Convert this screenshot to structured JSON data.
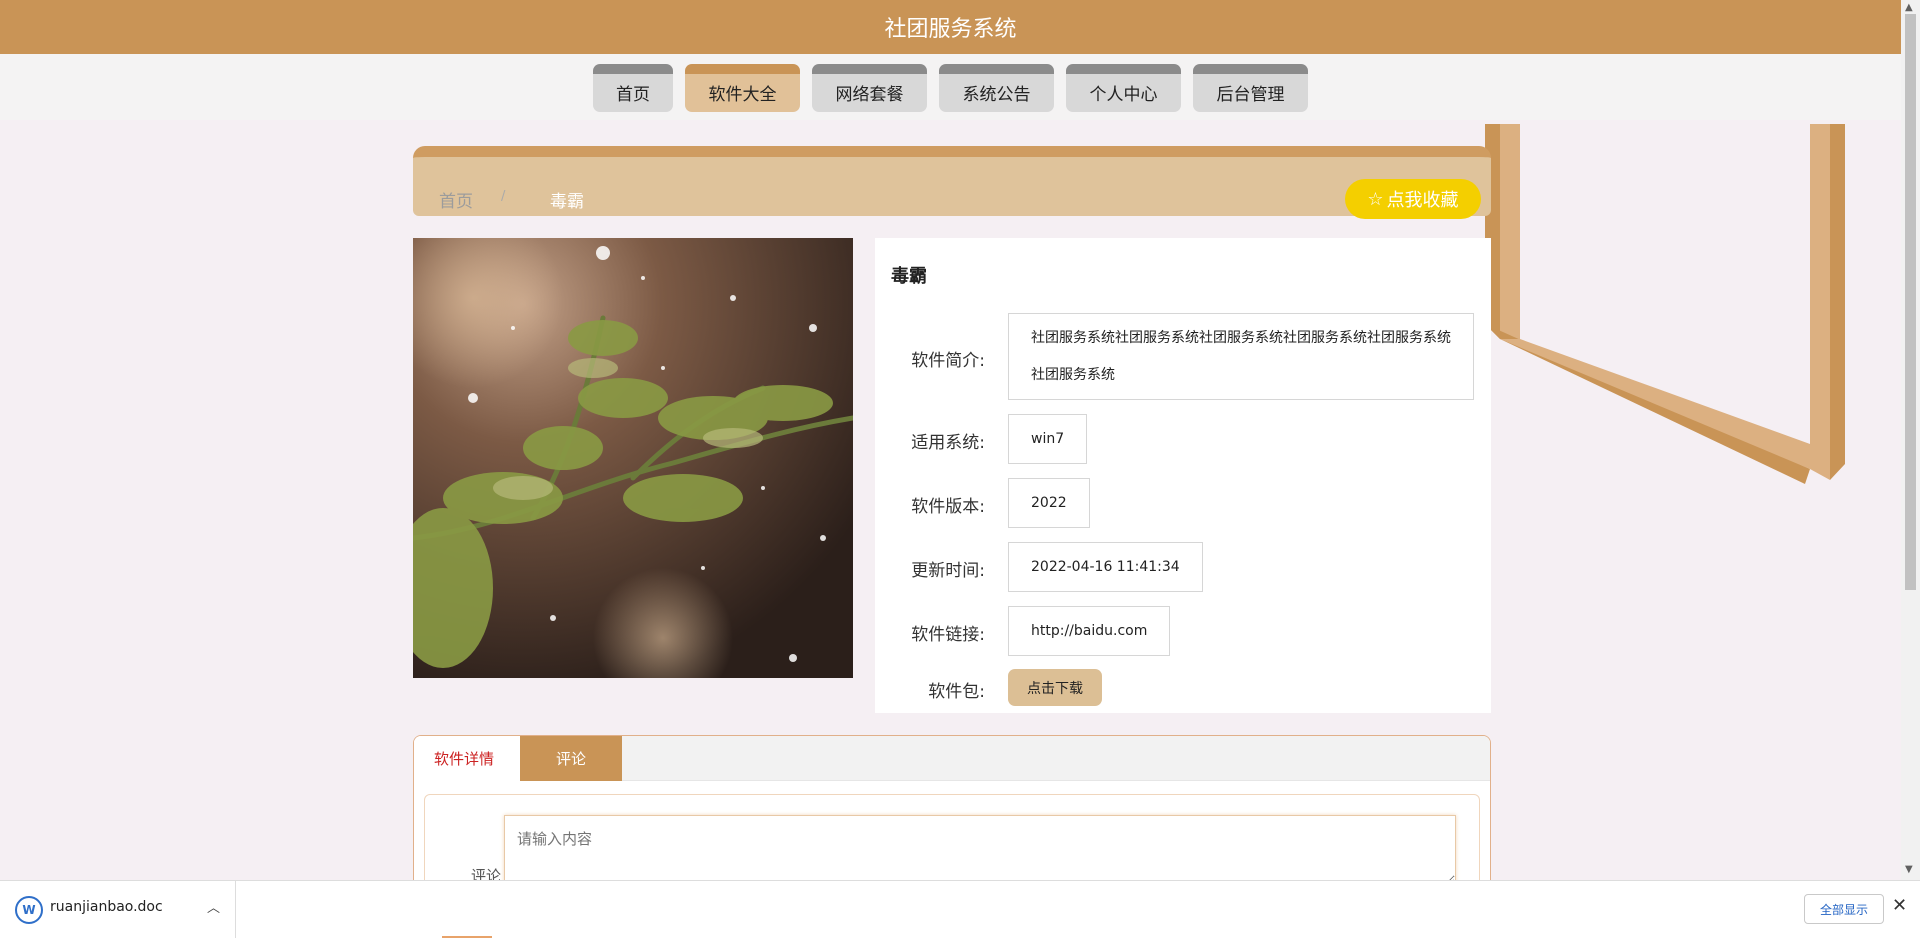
{
  "site": {
    "title": "社团服务系统"
  },
  "nav": [
    "首页",
    "软件大全",
    "网络套餐",
    "系统公告",
    "个人中心",
    "后台管理"
  ],
  "breadcrumb": {
    "home": "首页",
    "separator": "/",
    "current": "毒霸"
  },
  "favorite": {
    "icon": "☆",
    "label": "点我收藏"
  },
  "software": {
    "name": "毒霸",
    "labels": {
      "intro": "软件简介:",
      "os": "适用系统:",
      "version": "软件版本:",
      "updated": "更新时间:",
      "link": "软件链接:",
      "package": "软件包:"
    },
    "intro": "社团服务系统社团服务系统社团服务系统社团服务系统社团服务系统社团服务系统",
    "os": "win7",
    "version": "2022",
    "updated": "2022-04-16 11:41:34",
    "link": "http://baidu.com",
    "download_label": "点击下载"
  },
  "tabs": {
    "detail": "软件详情",
    "comment": "评论"
  },
  "comment": {
    "label": "评论",
    "placeholder": "请输入内容"
  },
  "downloads": {
    "file": "ruanjianbao.doc",
    "show_all": "全部显示",
    "close": "✕"
  },
  "colors": {
    "primary": "#c99456",
    "accent": "#f4cf00",
    "tab_active_text": "#cc2222"
  }
}
